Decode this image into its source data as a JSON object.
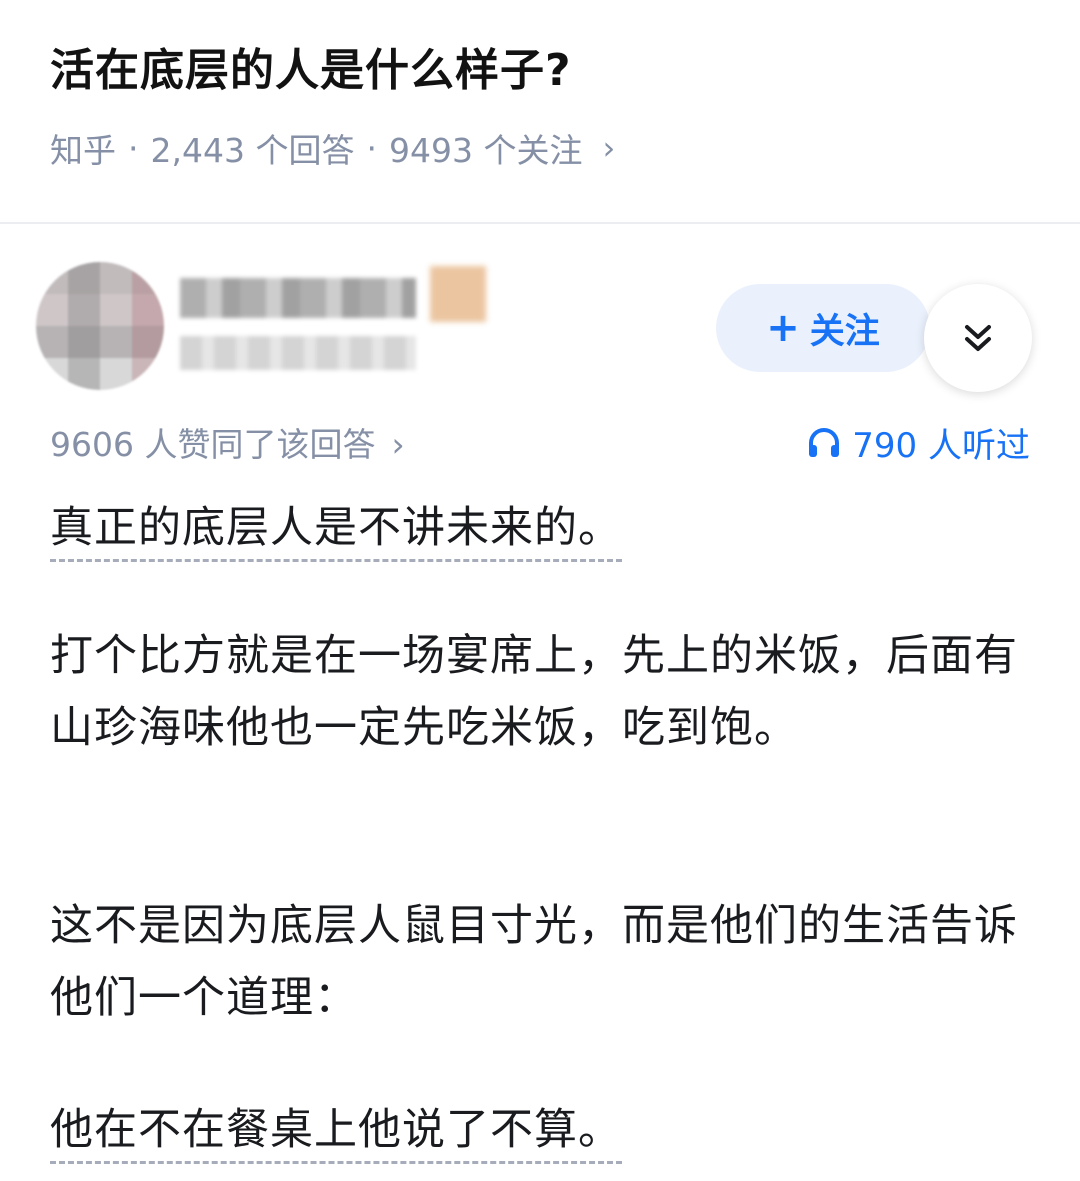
{
  "question": {
    "title": "活在底层的人是什么样子?",
    "source": "知乎",
    "answers": "2,443 个回答",
    "followers": "9493 个关注"
  },
  "author": {
    "follow_label": "关注"
  },
  "answer": {
    "upvotes": "9606 人赞同了该回答",
    "listens": "790 人听过",
    "paragraphs": [
      "真正的底层人是不讲未来的。",
      "打个比方就是在一场宴席上，先上的米饭，后面有山珍海味他也一定先吃米饭，吃到饱。",
      "这不是因为底层人鼠目寸光，而是他们的生活告诉他们一个道理：",
      "他在不在餐桌上他说了不算。"
    ]
  },
  "colors": {
    "accent": "#1772f6",
    "meta_gray": "#8590a6",
    "follow_bg": "#eaf1fd"
  },
  "icons": [
    "plus-icon",
    "double-chevron-down-icon",
    "headphones-icon",
    "chevron-right-icon"
  ]
}
